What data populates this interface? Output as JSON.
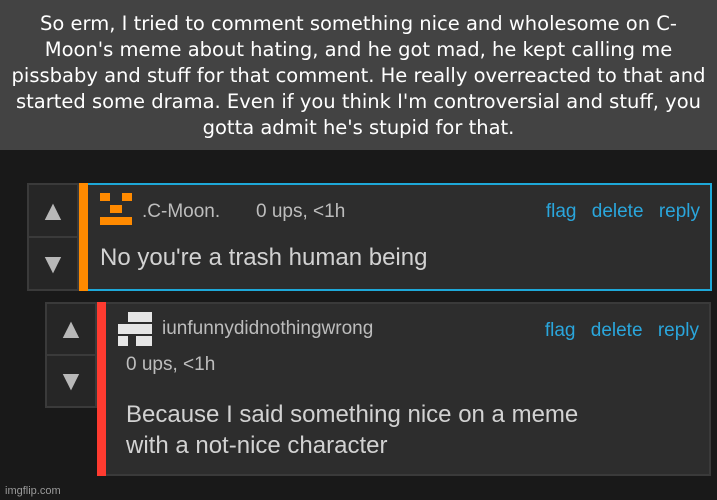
{
  "caption": "So erm, I tried to comment something nice and wholesome on C-Moon's meme about hating, and he got mad, he kept calling me pissbaby and stuff for that comment. He really overreacted to that and started some drama. Even if you think I'm controversial and stuff, you gotta admit he's stupid for that.",
  "comments": [
    {
      "username": ".C-Moon.",
      "meta": "0 ups, <1h",
      "text": "No you're a trash human being",
      "stripe_color": "#ff8a00",
      "actions": [
        "flag",
        "delete",
        "reply"
      ]
    },
    {
      "username": "iunfunnydidnothingwrong",
      "meta": "0 ups, <1h",
      "text_line1": "Because I said something nice on a meme",
      "text_line2": "with a not-nice character",
      "stripe_color": "#ff3b30",
      "actions": [
        "flag",
        "delete",
        "reply"
      ]
    }
  ],
  "icons": {
    "upvote": "▲",
    "downvote": "▼"
  },
  "accent_color": "#1ea8d8",
  "watermark": "imgflip.com"
}
